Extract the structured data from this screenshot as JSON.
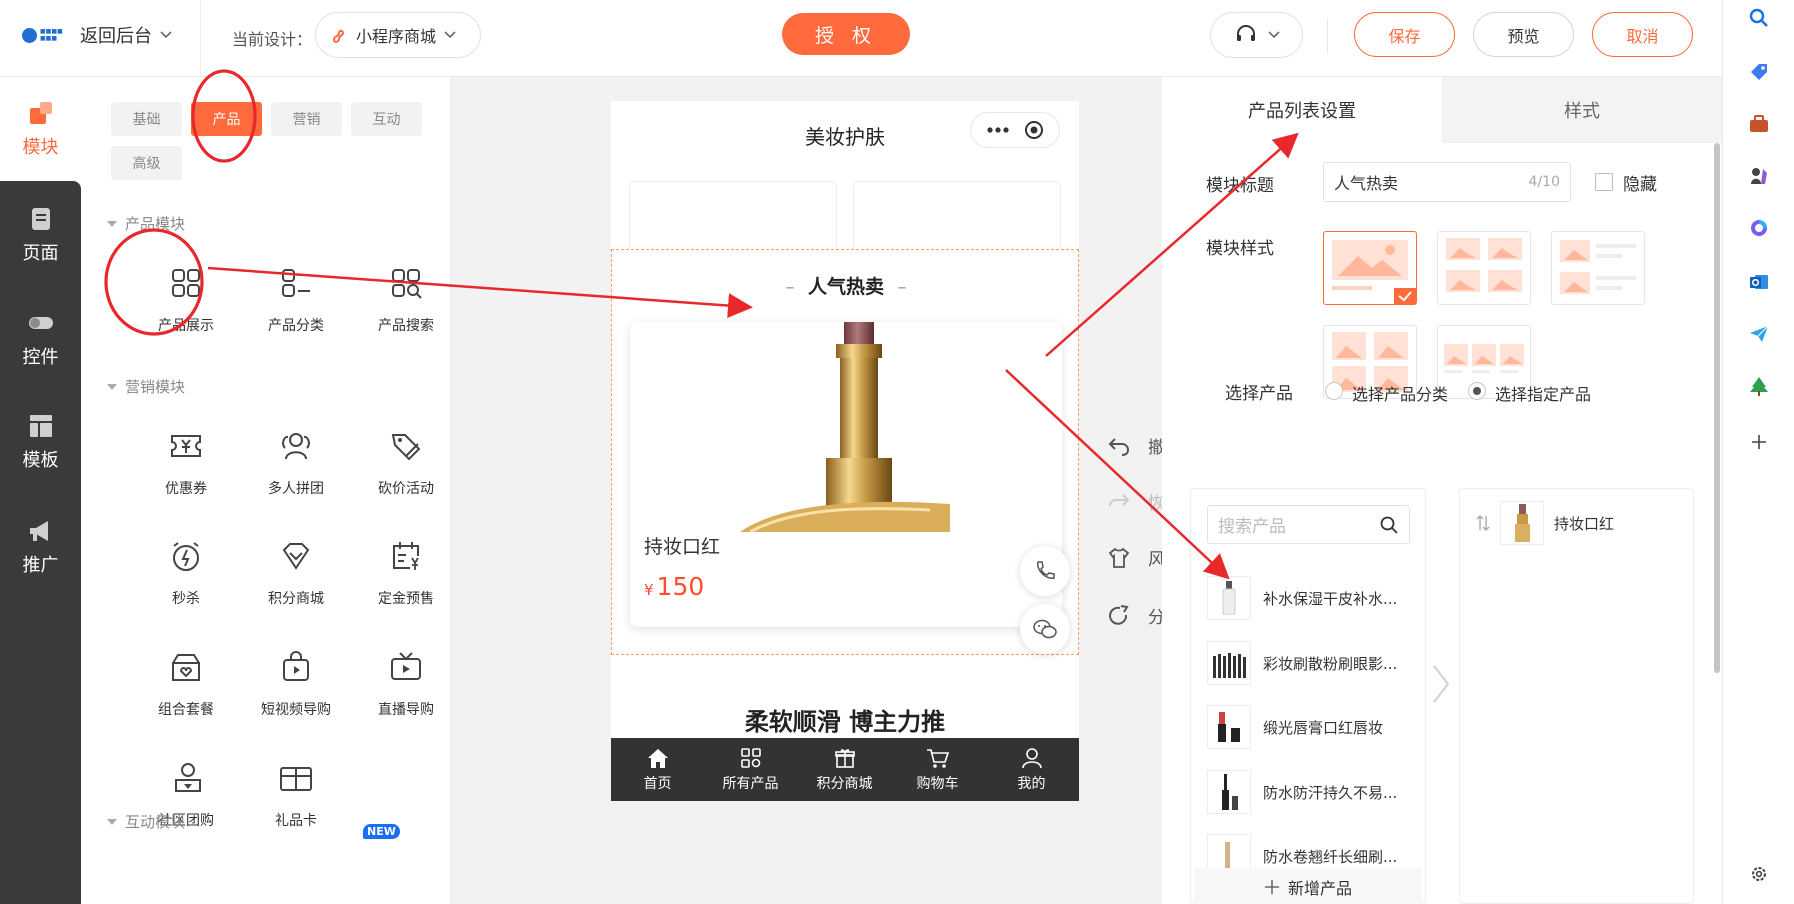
{
  "header": {
    "back_label": "返回后台",
    "design_label": "当前设计：",
    "design_value": "小程序商城",
    "auth_label": "授 权",
    "save_label": "保存",
    "preview_label": "预览",
    "cancel_label": "取消"
  },
  "leftnav": {
    "items": [
      {
        "label": "模块",
        "icon": "module-icon"
      },
      {
        "label": "页面",
        "icon": "page-icon"
      },
      {
        "label": "控件",
        "icon": "toggle-icon"
      },
      {
        "label": "模板",
        "icon": "template-icon"
      },
      {
        "label": "推广",
        "icon": "megaphone-icon"
      }
    ]
  },
  "components": {
    "tabs": [
      "基础",
      "产品",
      "营销",
      "互动",
      "高级"
    ],
    "active_tab": "产品",
    "sections": [
      {
        "title": "产品模块",
        "items": [
          "产品展示",
          "产品分类",
          "产品搜索"
        ]
      },
      {
        "title": "营销模块",
        "items": [
          "优惠券",
          "多人拼团",
          "砍价活动",
          "秒杀",
          "积分商城",
          "定金预售",
          "组合套餐",
          "短视频导购",
          "直播导购",
          "社区团购",
          "礼品卡"
        ]
      },
      {
        "title": "互动模块",
        "items": []
      }
    ],
    "new_badge": "NEW"
  },
  "phone": {
    "title": "美妆护肤",
    "section_title": "人气热卖",
    "product_name": "持妆口红",
    "price_symbol": "¥",
    "price": "150",
    "banner_title": "柔软顺滑  博主力推",
    "tabbar": [
      "首页",
      "所有产品",
      "积分商城",
      "购物车",
      "我的"
    ]
  },
  "tools": [
    "撤",
    "恢",
    "风",
    "分"
  ],
  "settings": {
    "tabs": [
      "产品列表设置",
      "样式"
    ],
    "module_title_label": "模块标题",
    "module_title_value": "人气热卖",
    "module_title_count": "4/10",
    "hide_label": "隐藏",
    "module_style_label": "模块样式",
    "select_product_label": "选择产品",
    "radio_options": [
      "选择产品分类",
      "选择指定产品"
    ],
    "radio_selected": "选择指定产品",
    "search_placeholder": "搜索产品",
    "product_list": [
      "补水保湿干皮补水...",
      "彩妆刷散粉刷眼影...",
      "缎光唇膏口红唇妆",
      "防水防汗持久不易...",
      "防水卷翘纤长细刷..."
    ],
    "add_label": "新增产品",
    "selected_products": [
      "持妆口红"
    ]
  },
  "colors": {
    "accent": "#ff6a3d",
    "annotation": "#e8282b",
    "dark_nav": "#3a3a3a"
  }
}
